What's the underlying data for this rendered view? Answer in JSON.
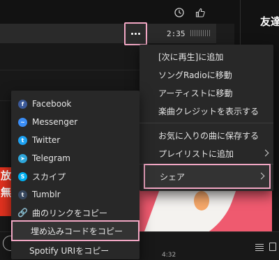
{
  "header": {
    "sidebar_title": "友達",
    "track_duration": "2:35",
    "bottom_time": "4:32"
  },
  "artwork": {
    "left_text_1": "放",
    "left_text_2": "無"
  },
  "context_menu": {
    "items": [
      {
        "label": "[次に再生]に追加"
      },
      {
        "label": "ソングRadioに移動"
      },
      {
        "label": "アーティストに移動"
      },
      {
        "label": "楽曲クレジットを表示する"
      },
      {
        "label": "お気に入りの曲に保存する"
      },
      {
        "label": "プレイリストに追加",
        "submenu": true
      },
      {
        "label": "シェア",
        "submenu": true,
        "highlighted": true
      }
    ]
  },
  "share_menu": {
    "items": [
      {
        "label": "Facebook",
        "icon": "facebook-icon",
        "icon_glyph": "f",
        "color": "#3b5998"
      },
      {
        "label": "Messenger",
        "icon": "messenger-icon",
        "icon_glyph": "~",
        "color": "#3a8df5"
      },
      {
        "label": "Twitter",
        "icon": "twitter-icon",
        "icon_glyph": "t",
        "color": "#1da1f2"
      },
      {
        "label": "Telegram",
        "icon": "telegram-icon",
        "icon_glyph": "➤",
        "color": "#2ea6da"
      },
      {
        "label": "スカイプ",
        "icon": "skype-icon",
        "icon_glyph": "S",
        "color": "#00aff0"
      },
      {
        "label": "Tumblr",
        "icon": "tumblr-icon",
        "icon_glyph": "t",
        "color": "#36465d"
      },
      {
        "label": "曲のリンクをコピー",
        "icon": "link-icon",
        "icon_glyph": "🔗"
      },
      {
        "label": "埋め込みコードをコピー",
        "highlighted": true
      },
      {
        "label": "Spotify URIをコピー"
      }
    ]
  },
  "colors": {
    "highlight_border": "#f2a7c4",
    "menu_bg": "#282828",
    "app_bg": "#121212"
  }
}
